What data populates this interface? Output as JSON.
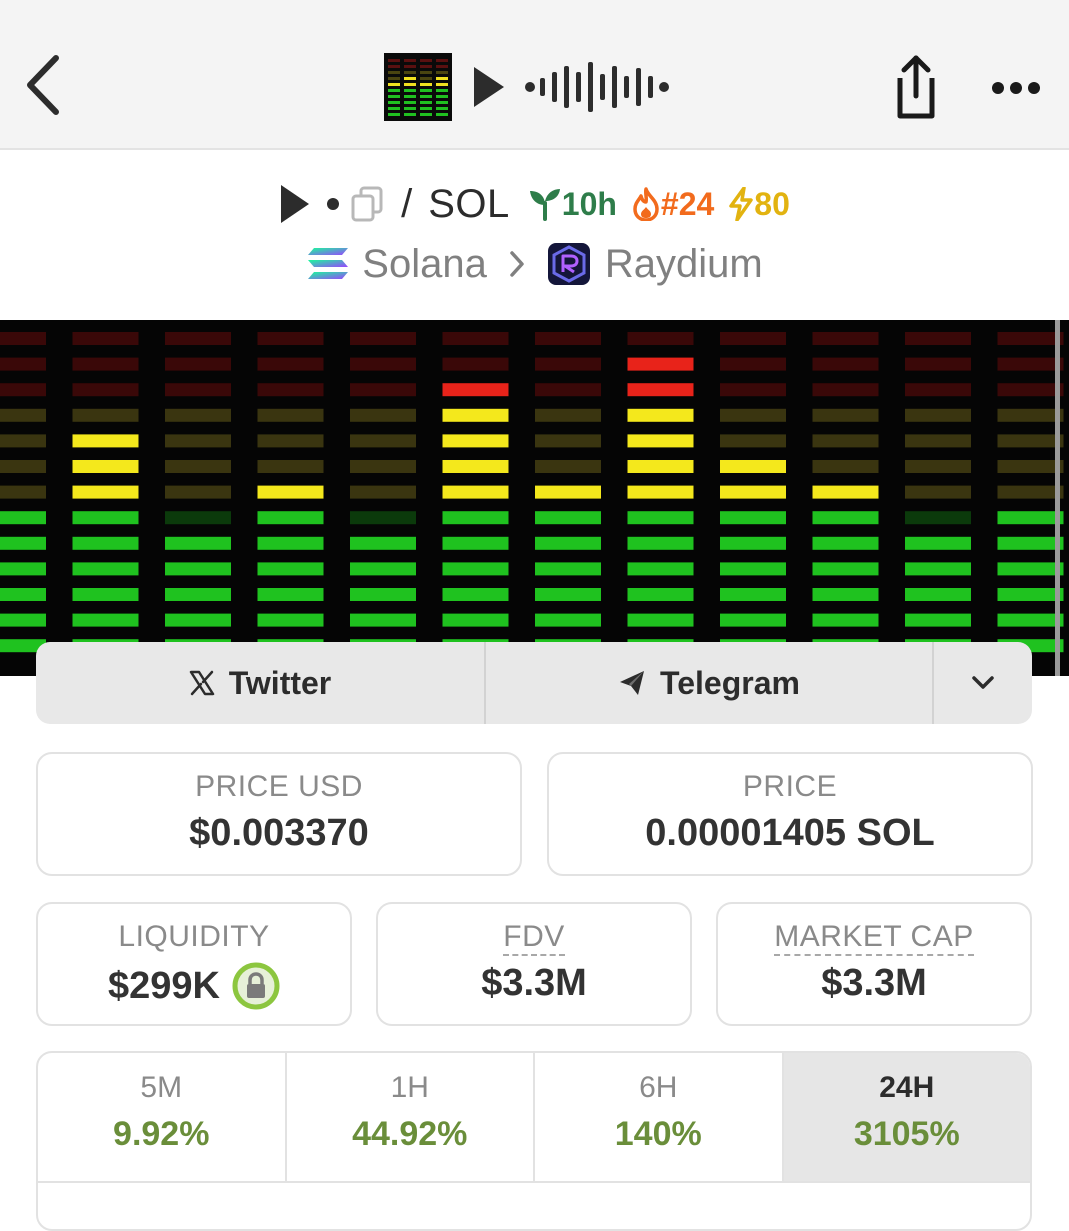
{
  "nav": {
    "back_icon": "chevron-left-icon",
    "title_icons": [
      "equalizer-thumbnail",
      "play-icon",
      "waveform-icon"
    ],
    "share_icon": "share-icon",
    "more_icon": "more-horizontal-icon"
  },
  "pair": {
    "base_icon": "play-icon",
    "copy_icon": "copy-icon",
    "separator": "/",
    "quote": "SOL",
    "age": "10h",
    "rank": "#24",
    "boost": "80",
    "colors": {
      "age": "#2e7d4a",
      "rank": "#f26b1d",
      "boost": "#e2b310"
    }
  },
  "chain": {
    "name": "Solana",
    "dex": "Raydium"
  },
  "socials": {
    "twitter": "Twitter",
    "telegram": "Telegram",
    "more_icon": "chevron-down-icon"
  },
  "stats": {
    "price_usd": {
      "label": "PRICE USD",
      "value": "$0.003370"
    },
    "price_sol": {
      "label": "PRICE",
      "value": "0.00001405 SOL"
    },
    "liquidity": {
      "label": "LIQUIDITY",
      "value": "$299K"
    },
    "fdv": {
      "label": "FDV",
      "value": "$3.3M"
    },
    "market_cap": {
      "label": "MARKET CAP",
      "value": "$3.3M"
    }
  },
  "timeframes": [
    {
      "label": "5M",
      "value": "9.92%"
    },
    {
      "label": "1H",
      "value": "44.92%"
    },
    {
      "label": "6H",
      "value": "140%"
    },
    {
      "label": "24H",
      "value": "3105%",
      "active": true
    }
  ],
  "accent": {
    "positive": "#6a8e3a"
  }
}
